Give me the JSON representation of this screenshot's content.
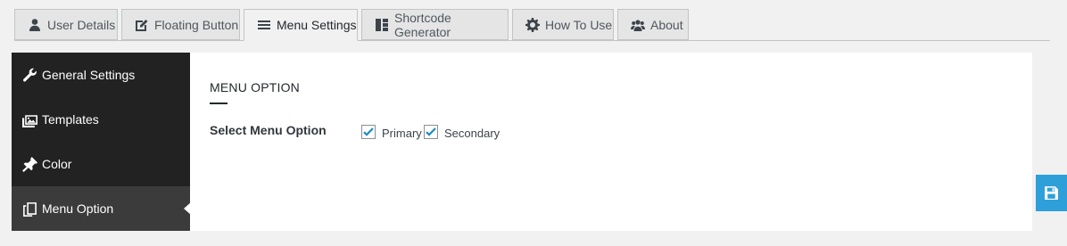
{
  "tabs": [
    {
      "label": "User Details",
      "icon": "user-icon",
      "active": false
    },
    {
      "label": "Floating Button",
      "icon": "edit-icon",
      "active": false
    },
    {
      "label": "Menu Settings",
      "icon": "menu-icon",
      "active": true
    },
    {
      "label": "Shortcode Generator",
      "icon": "layout-icon",
      "active": false
    },
    {
      "label": "How To Use",
      "icon": "gear-icon",
      "active": false
    },
    {
      "label": "About",
      "icon": "group-icon",
      "active": false
    }
  ],
  "sidebar": {
    "items": [
      {
        "label": "General Settings",
        "icon": "wrench-icon",
        "active": false
      },
      {
        "label": "Templates",
        "icon": "images-icon",
        "active": false
      },
      {
        "label": "Color",
        "icon": "pin-icon",
        "active": false
      },
      {
        "label": "Menu Option",
        "icon": "pages-icon",
        "active": true
      }
    ]
  },
  "content": {
    "title": "MENU OPTION",
    "field_label": "Select Menu Option",
    "options": [
      {
        "label": "Primary",
        "checked": true
      },
      {
        "label": "Secondary",
        "checked": true
      }
    ]
  },
  "save_button": {
    "icon": "save-icon"
  },
  "colors": {
    "accent": "#2e9fd8",
    "sidebar_bg": "#222222",
    "sidebar_active": "#3b3b3b",
    "check": "#1e8cbe"
  }
}
